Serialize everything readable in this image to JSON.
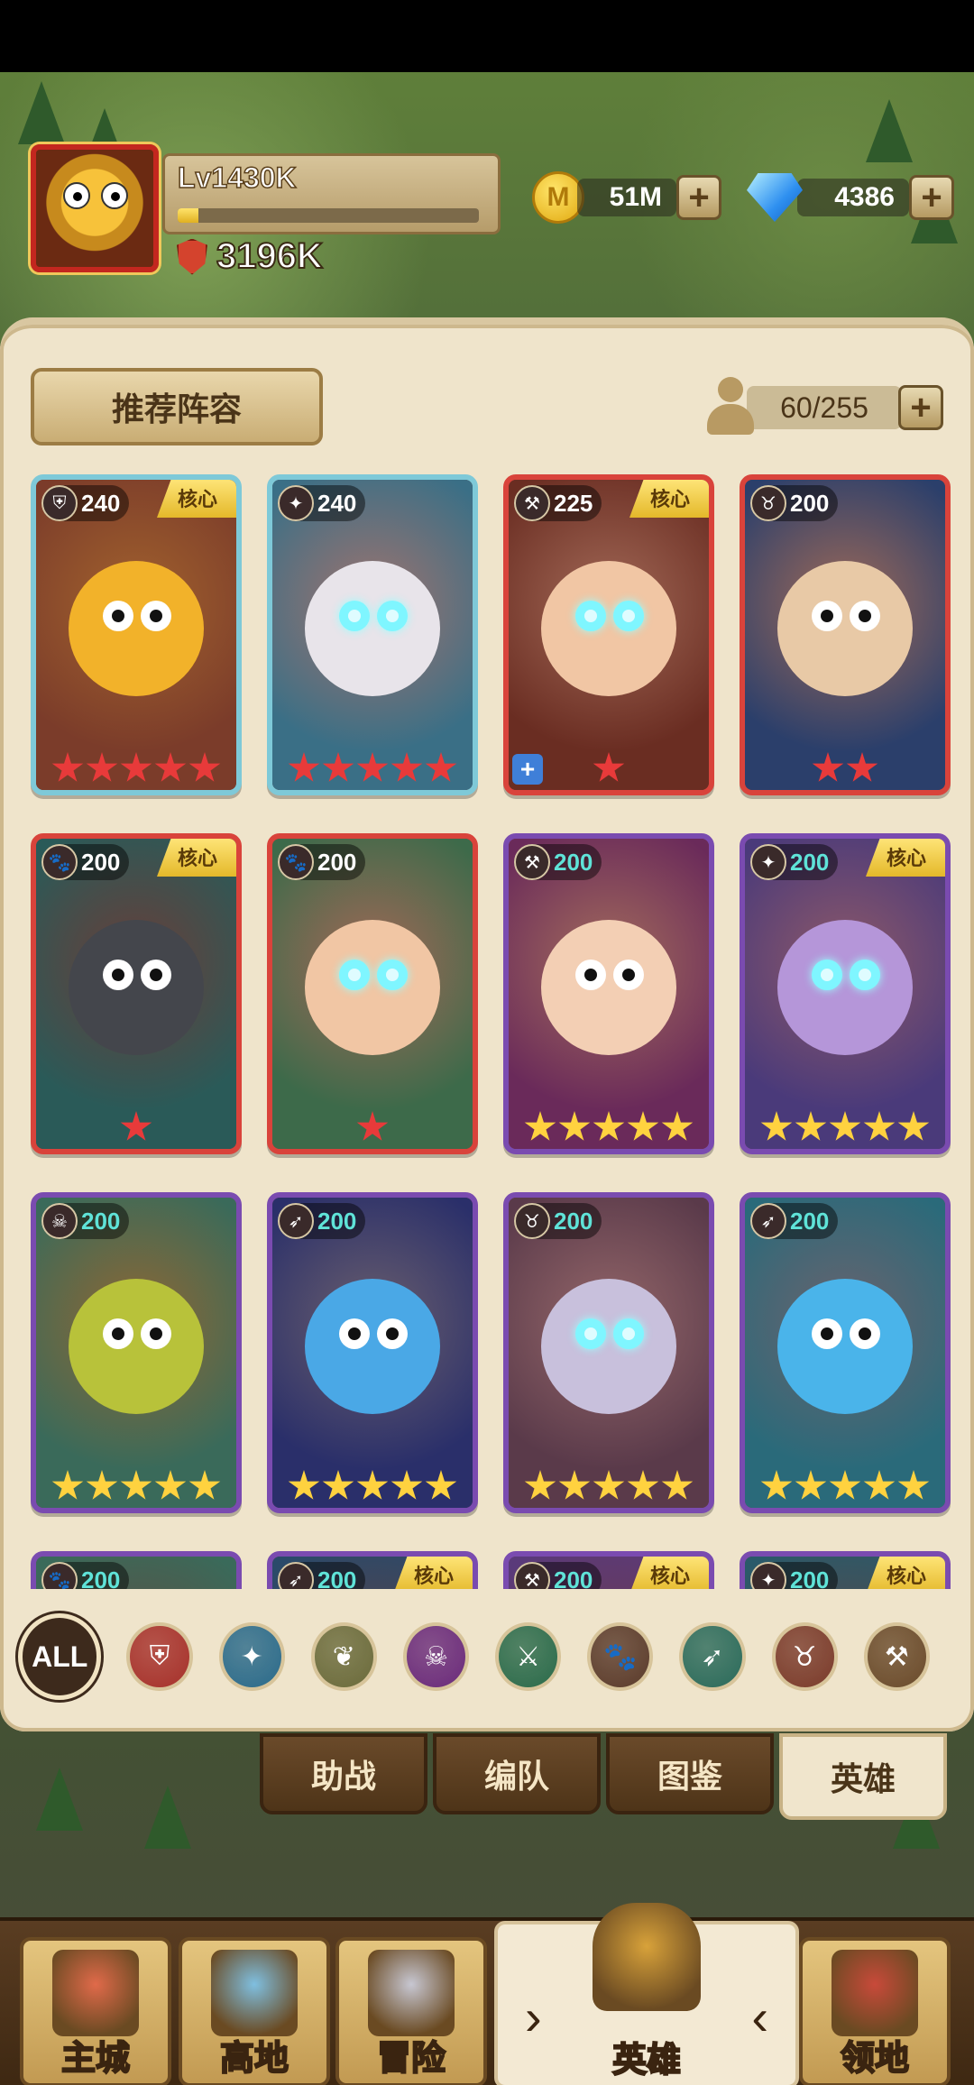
{
  "player": {
    "level": "Lv1430K",
    "xp_fraction": 0.07,
    "power": "3196K"
  },
  "currency": {
    "coins": "51M",
    "coin_icon_letter": "M",
    "gems": "4386"
  },
  "panel": {
    "recommend_button": "推荐阵容",
    "hero_count": "60/255"
  },
  "core_label": "核心",
  "heroes": [
    {
      "level": "240",
      "class": "shield-icon",
      "core": true,
      "stars": 5,
      "star_color": "red",
      "frame": "blue",
      "bg": "#7b3c2a",
      "face": "#f2b22a"
    },
    {
      "level": "240",
      "class": "light-icon",
      "core": false,
      "stars": 5,
      "star_color": "red",
      "frame": "blue",
      "bg": "#3a6f86",
      "face": "#e8e4ea"
    },
    {
      "level": "225",
      "class": "hammer-icon",
      "core": true,
      "stars": 1,
      "star_color": "red",
      "frame": "red",
      "bg": "#6a2d22",
      "face": "#f1c6a4",
      "plus": true
    },
    {
      "level": "200",
      "class": "demon-icon",
      "core": false,
      "stars": 2,
      "star_color": "red",
      "frame": "red",
      "bg": "#2b3f6b",
      "face": "#e8c9a6"
    },
    {
      "level": "200",
      "class": "paw-icon",
      "core": true,
      "stars": 1,
      "star_color": "red",
      "frame": "red",
      "bg": "#2a5a58",
      "face": "#44464c"
    },
    {
      "level": "200",
      "class": "paw-icon",
      "core": false,
      "stars": 1,
      "star_color": "red",
      "frame": "red",
      "bg": "#3d6a4a",
      "face": "#f1c6a4"
    },
    {
      "level": "200",
      "class": "hammer-icon",
      "core": false,
      "stars": 5,
      "star_color": "gold",
      "frame": "purple",
      "bg": "#6a2a5a",
      "face": "#f3cfb4"
    },
    {
      "level": "200",
      "class": "light-icon",
      "core": true,
      "stars": 5,
      "star_color": "gold",
      "frame": "purple",
      "bg": "#4a3a7a",
      "face": "#b596d9"
    },
    {
      "level": "200",
      "class": "skull-icon",
      "core": false,
      "stars": 5,
      "star_color": "gold",
      "frame": "purple",
      "bg": "#3a6a5a",
      "face": "#b8c23a"
    },
    {
      "level": "200",
      "class": "bow-icon",
      "core": false,
      "stars": 5,
      "star_color": "gold",
      "frame": "purple",
      "bg": "#2a2f6a",
      "face": "#4aa8e6"
    },
    {
      "level": "200",
      "class": "demon-icon",
      "core": false,
      "stars": 5,
      "star_color": "gold",
      "frame": "purple",
      "bg": "#5a3a4a",
      "face": "#c8c0dc"
    },
    {
      "level": "200",
      "class": "bow-icon",
      "core": false,
      "stars": 5,
      "star_color": "gold",
      "frame": "purple",
      "bg": "#2a6a7a",
      "face": "#4ab4ea"
    },
    {
      "level": "200",
      "class": "paw-icon",
      "core": false,
      "stars": 0,
      "star_color": "gold",
      "frame": "purple",
      "bg": "#3a6a5a",
      "face": "#3a6a5a"
    },
    {
      "level": "200",
      "class": "bow-icon",
      "core": true,
      "stars": 0,
      "star_color": "gold",
      "frame": "purple",
      "bg": "#2a4a6a",
      "face": "#2a4a6a"
    },
    {
      "level": "200",
      "class": "hammer-icon",
      "core": true,
      "stars": 0,
      "star_color": "gold",
      "frame": "purple",
      "bg": "#5a3a7a",
      "face": "#5a3a7a"
    },
    {
      "level": "200",
      "class": "light-icon",
      "core": true,
      "stars": 0,
      "star_color": "gold",
      "frame": "purple",
      "bg": "#2a5a6a",
      "face": "#2a5a6a"
    }
  ],
  "filters": [
    {
      "label": "ALL",
      "icon": "all-filter",
      "color": "#3d2a1c"
    },
    {
      "label": "",
      "icon": "shield-icon",
      "color": "#a6302a"
    },
    {
      "label": "",
      "icon": "light-icon",
      "color": "#2a6a8a"
    },
    {
      "label": "",
      "icon": "winged-emblem-icon",
      "color": "#6a6a3a"
    },
    {
      "label": "",
      "icon": "skull-icon",
      "color": "#6a2a7a"
    },
    {
      "label": "",
      "icon": "crossed-swords-icon",
      "color": "#2a6a4a"
    },
    {
      "label": "",
      "icon": "paw-icon",
      "color": "#5a3a2a"
    },
    {
      "label": "",
      "icon": "bow-icon",
      "color": "#2a6a5a"
    },
    {
      "label": "",
      "icon": "demon-icon",
      "color": "#7a3a2a"
    },
    {
      "label": "",
      "icon": "hammer-icon",
      "color": "#6a4a2a"
    }
  ],
  "tabs": [
    "助战",
    "编队",
    "图鉴",
    "英雄"
  ],
  "active_tab": 3,
  "bottom_nav": [
    {
      "label": "主城",
      "icon": "castle-icon"
    },
    {
      "label": "高地",
      "icon": "highland-icon"
    },
    {
      "label": "冒险",
      "icon": "crossed-swords-icon"
    },
    {
      "label": "英雄",
      "icon": "helmet-icon"
    },
    {
      "label": "领地",
      "icon": "banner-icon"
    }
  ],
  "active_nav": 3
}
